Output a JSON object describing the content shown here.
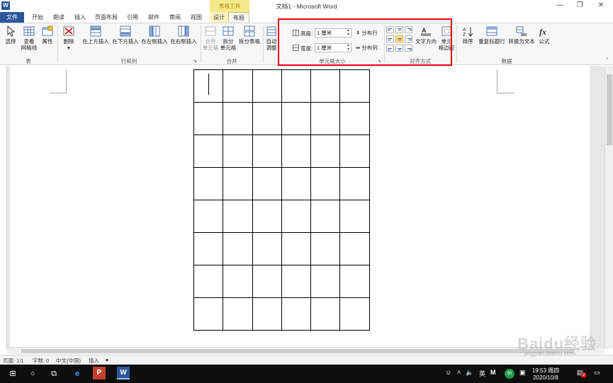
{
  "window": {
    "title": "文档1 - Microsoft Word",
    "context_tab_group": "表格工具",
    "app_icon_letter": "W",
    "controls": {
      "minimize": "—",
      "restore": "❐",
      "close": "✕"
    }
  },
  "tabs": [
    "文件",
    "开始",
    "朗读",
    "插入",
    "页面布局",
    "引用",
    "邮件",
    "审阅",
    "视图",
    "设计",
    "布局"
  ],
  "ribbon": {
    "groups": {
      "table": {
        "label": "表",
        "buttons": {
          "select": "选择",
          "view_gridlines_1": "查看",
          "view_gridlines_2": "网格线",
          "properties": "属性"
        }
      },
      "rows_cols": {
        "label": "行和列",
        "buttons": {
          "delete": "删除",
          "insert_above": "在上方插入",
          "insert_below": "在下方插入",
          "insert_left": "在左侧插入",
          "insert_right": "在右侧插入"
        }
      },
      "merge": {
        "label": "合并",
        "buttons": {
          "merge_cells_1": "合并",
          "merge_cells_2": "单元格",
          "split_cells_1": "拆分",
          "split_cells_2": "单元格",
          "split_table": "拆分表格"
        }
      },
      "autofit": {
        "label": "自动调整"
      },
      "cell_size": {
        "label": "单元格大小",
        "height_label": "高度:",
        "height_value": "1 厘米",
        "width_label": "宽度:",
        "width_value": "1 厘米",
        "distribute_rows": "分布行",
        "distribute_cols": "分布列"
      },
      "alignment": {
        "label": "对齐方式",
        "text_direction": "文字方向",
        "cell_margins_1": "单元",
        "cell_margins_2": "格边距"
      },
      "data": {
        "label": "数据",
        "buttons": {
          "sort": "排序",
          "repeat_header": "重复标题行",
          "convert_to_text": "转换为文本",
          "formula": "公式"
        }
      }
    }
  },
  "table": {
    "rows": 8,
    "cols": 6
  },
  "statusbar": {
    "page": "页面: 1/1",
    "words": "字数: 0",
    "language": "中文(中国)",
    "mode": "插入"
  },
  "taskbar": {
    "ime": "英",
    "badge": "65",
    "time": "19:53 周四",
    "date": "2020/10/8",
    "notif_count": "2"
  },
  "watermark": {
    "brand": "Baidu经验",
    "url": "jingyan.baidu.com"
  }
}
